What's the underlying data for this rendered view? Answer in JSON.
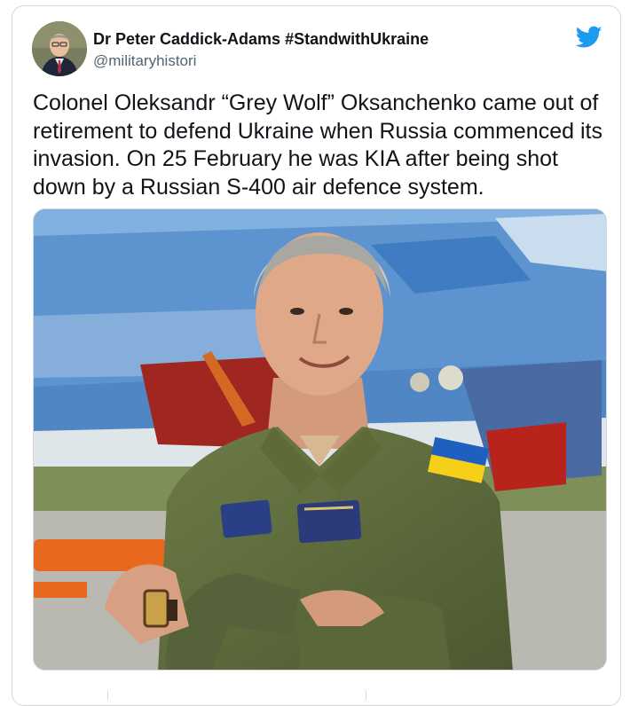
{
  "tweet": {
    "author_name": "Dr Peter Caddick-Adams #StandwithUkraine",
    "author_handle": "@militaryhistori",
    "text": "Colonel Oleksandr “Grey Wolf” Oksanchenko came out of retirement to defend Ukraine when Russia commenced its invasion. On 25 February he was KIA after being shot down by a Russian S-400 air defence system."
  },
  "colors": {
    "twitter_blue": "#1d9bf0",
    "flag_blue": "#1f5fbf",
    "flag_yellow": "#f6d018",
    "flight_suit": "#5c6a3a"
  },
  "icons": [
    "twitter-bird-icon"
  ]
}
